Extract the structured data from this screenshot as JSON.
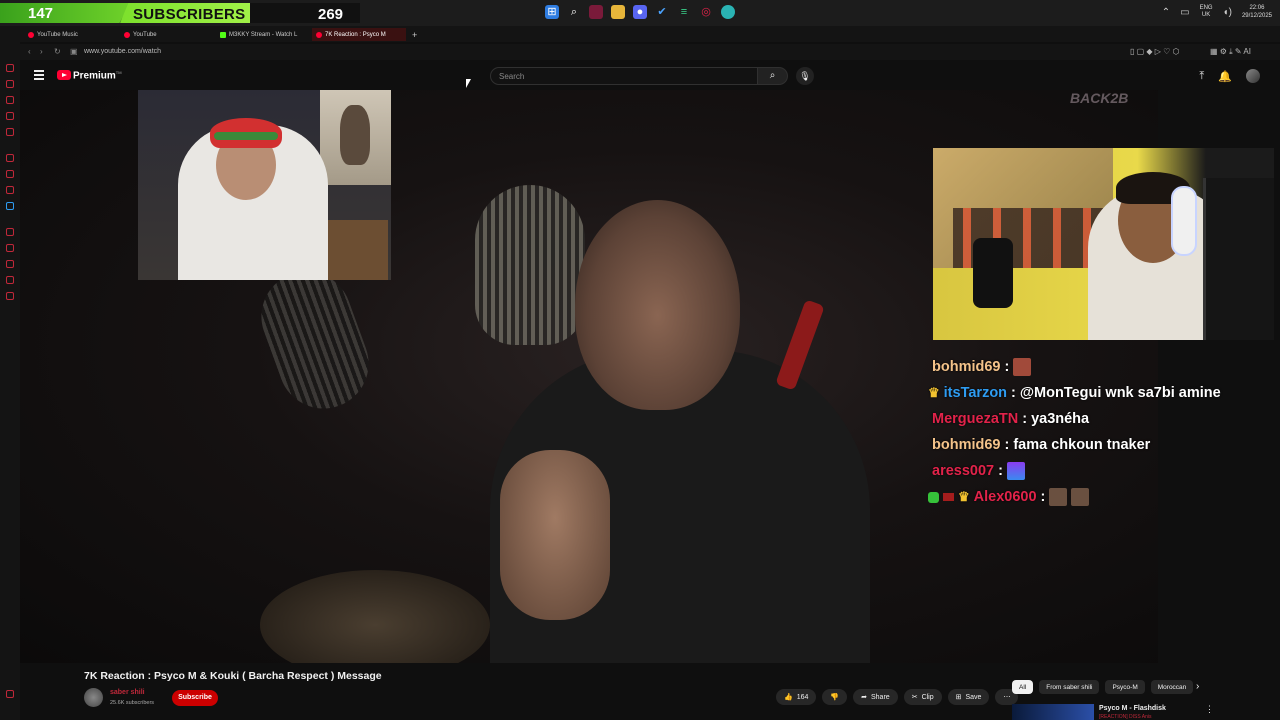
{
  "overlay": {
    "subscriber_count": "147",
    "subscriber_label": "SUBSCRIBERS",
    "subscriber_goal": "269"
  },
  "taskbar": {
    "language": "ENG",
    "region": "UK",
    "time": "22:06",
    "date": "29/12/2025",
    "icons": [
      "windows-start-icon",
      "search-icon",
      "app-icon",
      "file-explorer-icon",
      "discord-icon",
      "steam-icon",
      "app-icon",
      "opera-icon",
      "globe-icon"
    ]
  },
  "browser": {
    "tabs": [
      {
        "label": "YouTube Music",
        "color": "#ff0033"
      },
      {
        "label": "YouTube",
        "color": "#ff0033"
      },
      {
        "label": "M3KKY Stream - Watch L",
        "color": "#53fc18"
      },
      {
        "label": "7K Reaction : Psyco M",
        "color": "#ff0033",
        "active": true
      }
    ],
    "url": "www.youtube.com/watch"
  },
  "youtube": {
    "brand": "Premium",
    "brand_sup": "TM",
    "search_placeholder": "Search"
  },
  "video_wall_text": "BACK2B",
  "chat": [
    {
      "user": "bohmid69",
      "color": "#f4c38a",
      "text": "",
      "emote": true
    },
    {
      "user": "itsTarzon",
      "color": "#2e9cf2",
      "text": "@MonTegui wnk sa7bi amine",
      "crown": true
    },
    {
      "user": "MerguezaTN",
      "color": "#e2234a",
      "text": "ya3néha"
    },
    {
      "user": "bohmid69",
      "color": "#f4c38a",
      "text": "fama chkoun tnaker"
    },
    {
      "user": "aress007",
      "color": "#e2234a",
      "text": "",
      "emote": true
    },
    {
      "user": "Alex0600",
      "color": "#e2234a",
      "text": "",
      "emote": true,
      "badges": true
    }
  ],
  "video_info": {
    "title": "7K Reaction : Psyco M & Kouki ( Barcha Respect ) Message",
    "channel": "saber shili",
    "subscribers": "25.6K subscribers",
    "subscribe_label": "Subscribe",
    "likes": "164",
    "share_label": "Share",
    "clip_label": "Clip",
    "save_label": "Save"
  },
  "chips": [
    "All",
    "From saber shili",
    "Psyco-M",
    "Moroccan"
  ],
  "recommendation": {
    "title": "Psyco M - Flashdisk",
    "subtitle": "[REACTION] DISS Anis"
  }
}
